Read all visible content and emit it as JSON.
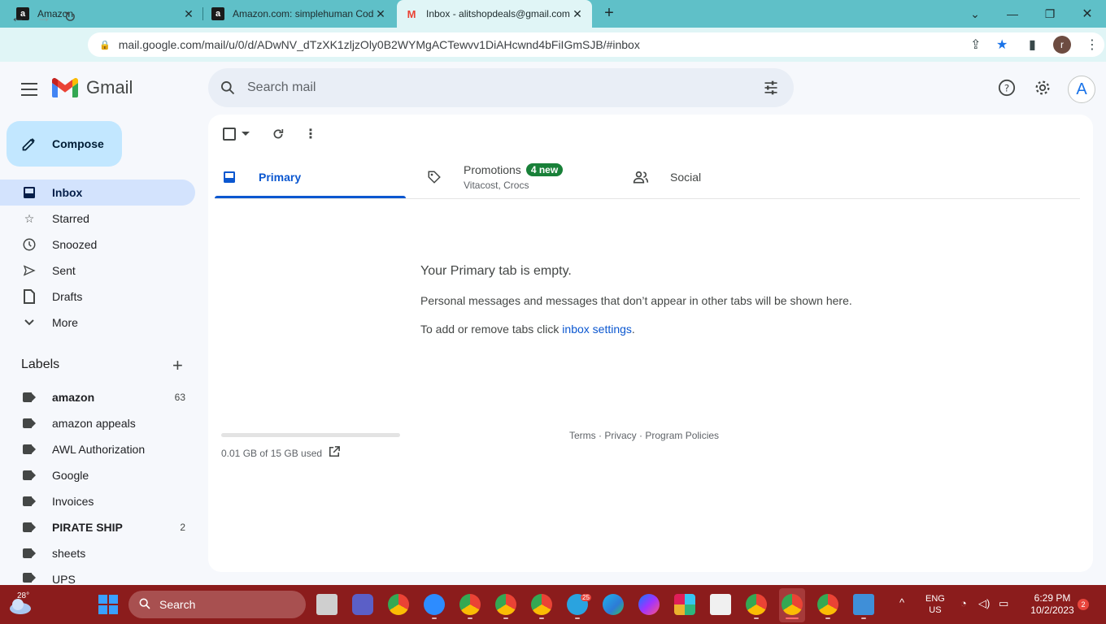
{
  "browser": {
    "tabs": [
      {
        "title": "Amazon",
        "favicon": "amazon-icon"
      },
      {
        "title": "Amazon.com: simplehuman Cod",
        "favicon": "amazon-icon"
      },
      {
        "title": "Inbox - alitshopdeals@gmail.com",
        "favicon": "gmail-icon"
      }
    ],
    "url": "mail.google.com/mail/u/0/d/ADwNV_dTzXK1zljzOly0B2WYMgACTewvv1DiAHcwnd4bFiIGmSJB/#inbox",
    "profile_initial": "r"
  },
  "gmail": {
    "title": "Gmail",
    "search_placeholder": "Search mail",
    "account_initial": "A",
    "compose_label": "Compose",
    "nav": [
      {
        "label": "Inbox",
        "icon": "inbox-icon"
      },
      {
        "label": "Starred",
        "icon": "star-icon"
      },
      {
        "label": "Snoozed",
        "icon": "clock-icon"
      },
      {
        "label": "Sent",
        "icon": "send-icon"
      },
      {
        "label": "Drafts",
        "icon": "draft-icon"
      },
      {
        "label": "More",
        "icon": "chevron-down-icon"
      }
    ],
    "labels_title": "Labels",
    "labels": [
      {
        "name": "amazon",
        "count": "63",
        "bold": true
      },
      {
        "name": "amazon appeals",
        "count": ""
      },
      {
        "name": "AWL Authorization",
        "count": ""
      },
      {
        "name": "Google",
        "count": ""
      },
      {
        "name": "Invoices",
        "count": ""
      },
      {
        "name": "PIRATE SHIP",
        "count": "2",
        "bold": true
      },
      {
        "name": "sheets",
        "count": ""
      },
      {
        "name": "UPS",
        "count": ""
      }
    ],
    "category_tabs": {
      "primary": "Primary",
      "promotions": "Promotions",
      "promotions_badge": "4 new",
      "promotions_senders": "Vitacost, Crocs",
      "social": "Social"
    },
    "empty": {
      "title": "Your Primary tab is empty.",
      "line1": "Personal messages and messages that don’t appear in other tabs will be shown here.",
      "line2_prefix": "To add or remove tabs click ",
      "line2_link": "inbox settings",
      "line2_suffix": "."
    },
    "storage": {
      "text": "0.01 GB of 15 GB used"
    },
    "footer": {
      "terms": "Terms",
      "privacy": "Privacy",
      "policies": "Program Policies",
      "sep": " · "
    }
  },
  "taskbar": {
    "temperature": "28°",
    "search_label": "Search",
    "lang_line1": "ENG",
    "lang_line2": "US",
    "time": "6:29 PM",
    "date": "10/2/2023",
    "notifications": "2",
    "telegram_badge": "25"
  }
}
